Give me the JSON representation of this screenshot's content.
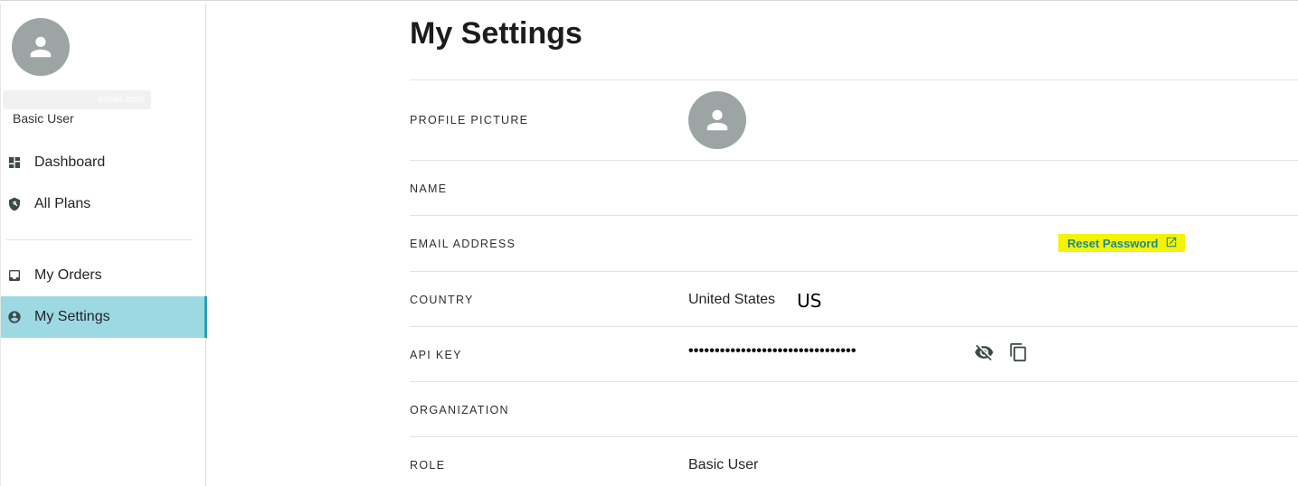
{
  "sidebar": {
    "user_email": "email.com",
    "user_role": "Basic User",
    "items": [
      {
        "label": "Dashboard",
        "icon": "dashboard-icon"
      },
      {
        "label": "All Plans",
        "icon": "shield-icon"
      },
      {
        "label": "My Orders",
        "icon": "inbox-icon"
      },
      {
        "label": "My Settings",
        "icon": "account-circle-icon",
        "active": true
      }
    ]
  },
  "page": {
    "title": "My Settings"
  },
  "settings": {
    "profile_picture_label": "PROFILE PICTURE",
    "name_label": "NAME",
    "email_label": "EMAIL ADDRESS",
    "reset_password_label": "Reset Password",
    "country_label": "COUNTRY",
    "country_value": "United States",
    "country_code": "US",
    "api_key_label": "API KEY",
    "api_key_value": "••••••••••••••••••••••••••••••••",
    "organization_label": "ORGANIZATION",
    "role_label": "ROLE",
    "role_value": "Basic User"
  },
  "colors": {
    "active_nav_bg": "#9dd9e2",
    "active_nav_border": "#2a9fb3",
    "link": "#1d8a8a",
    "highlight": "#f4f400",
    "avatar": "#9da5a4"
  }
}
